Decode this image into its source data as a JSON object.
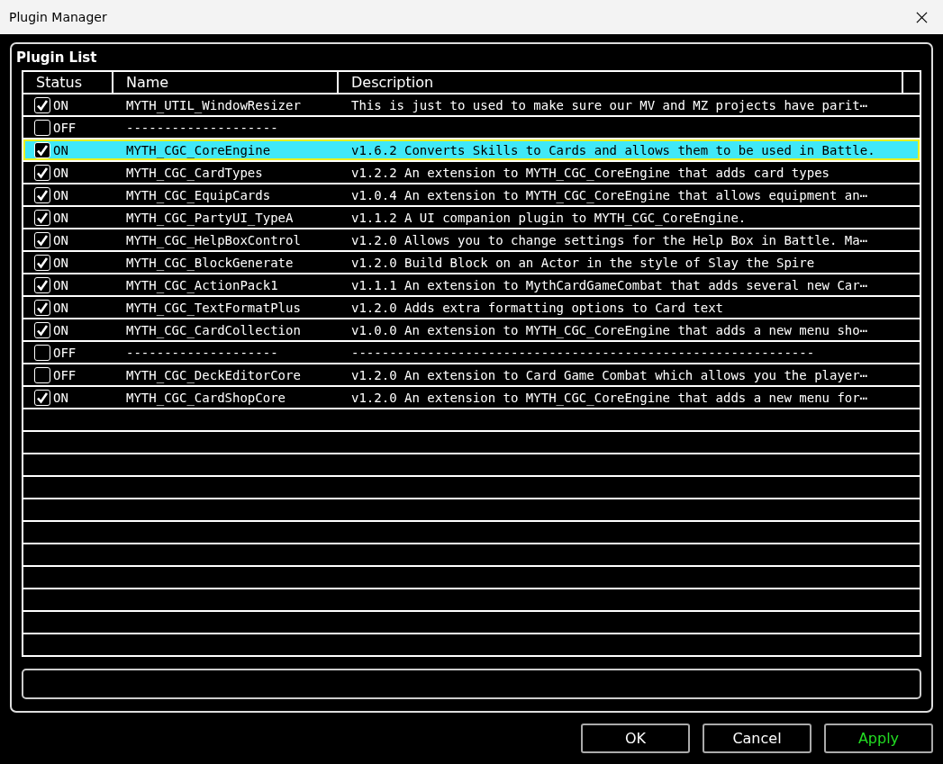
{
  "window": {
    "title": "Plugin Manager"
  },
  "panel": {
    "title": "Plugin List"
  },
  "table": {
    "columns": [
      "Status",
      "Name",
      "Description"
    ],
    "rows": [
      {
        "checked": true,
        "status": "ON",
        "name": "MYTH_UTIL_WindowResizer",
        "description": "This is just to used to make sure our MV and MZ projects have parit⋯",
        "selected": false
      },
      {
        "checked": false,
        "status": "OFF",
        "name": "--------------------",
        "description": "",
        "selected": false
      },
      {
        "checked": true,
        "status": "ON",
        "name": "MYTH_CGC_CoreEngine",
        "description": "v1.6.2 Converts Skills to Cards and allows them to be used in Battle.",
        "selected": true
      },
      {
        "checked": true,
        "status": "ON",
        "name": "MYTH_CGC_CardTypes",
        "description": "v1.2.2 An extension to MYTH_CGC_CoreEngine that adds card types",
        "selected": false
      },
      {
        "checked": true,
        "status": "ON",
        "name": "MYTH_CGC_EquipCards",
        "description": "v1.0.4 An extension to MYTH_CGC_CoreEngine that allows equipment an⋯",
        "selected": false
      },
      {
        "checked": true,
        "status": "ON",
        "name": "MYTH_CGC_PartyUI_TypeA",
        "description": "v1.1.2 A UI companion plugin to MYTH_CGC_CoreEngine.",
        "selected": false
      },
      {
        "checked": true,
        "status": "ON",
        "name": "MYTH_CGC_HelpBoxControl",
        "description": "v1.2.0 Allows you to change settings for the Help Box in Battle. Ma⋯",
        "selected": false
      },
      {
        "checked": true,
        "status": "ON",
        "name": "MYTH_CGC_BlockGenerate",
        "description": "v1.2.0 Build Block on an Actor in the style of Slay the Spire",
        "selected": false
      },
      {
        "checked": true,
        "status": "ON",
        "name": "MYTH_CGC_ActionPack1",
        "description": "v1.1.1 An extension to MythCardGameCombat that adds several new Car⋯",
        "selected": false
      },
      {
        "checked": true,
        "status": "ON",
        "name": "MYTH_CGC_TextFormatPlus",
        "description": "v1.2.0 Adds extra formatting options to Card text",
        "selected": false
      },
      {
        "checked": true,
        "status": "ON",
        "name": "MYTH_CGC_CardCollection",
        "description": "v1.0.0 An extension to MYTH_CGC_CoreEngine that adds a new menu sho⋯",
        "selected": false
      },
      {
        "checked": false,
        "status": "OFF",
        "name": "--------------------",
        "description": "-------------------------------------------------------------",
        "selected": false
      },
      {
        "checked": false,
        "status": "OFF",
        "name": "MYTH_CGC_DeckEditorCore",
        "description": "v1.2.0 An extension to Card Game Combat which allows you the player⋯",
        "selected": false
      },
      {
        "checked": true,
        "status": "ON",
        "name": "MYTH_CGC_CardShopCore",
        "description": "v1.2.0 An extension to MYTH_CGC_CoreEngine that adds a new menu for⋯",
        "selected": false
      }
    ]
  },
  "buttons": [
    {
      "label": "OK",
      "kind": "normal"
    },
    {
      "label": "Cancel",
      "kind": "normal"
    },
    {
      "label": "Apply",
      "kind": "apply"
    }
  ]
}
